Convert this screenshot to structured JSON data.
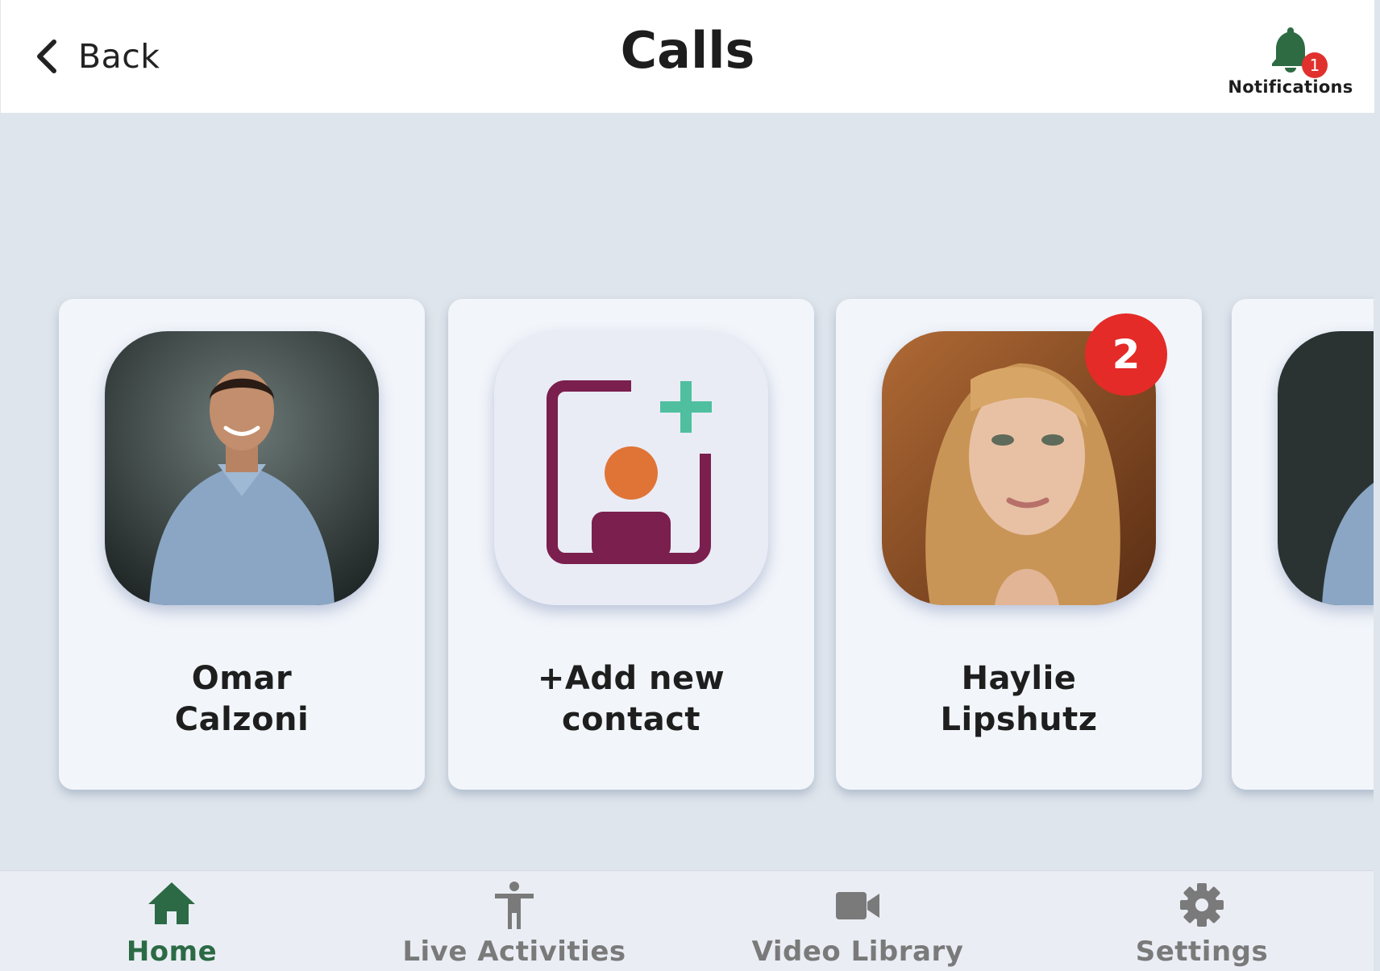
{
  "header": {
    "back_label": "Back",
    "title": "Calls",
    "notifications": {
      "label": "Notifications",
      "count": "1",
      "icon": "bell-icon",
      "icon_color": "#2e6b43",
      "badge_color": "#e0312e"
    }
  },
  "contacts": [
    {
      "first": "Omar",
      "last": "Calzoni",
      "badge": null
    },
    {
      "first": "+Add new",
      "last": "contact",
      "action": "add-contact"
    },
    {
      "first": "Haylie",
      "last": "Lipshutz",
      "badge": "2"
    }
  ],
  "nav": {
    "items": [
      {
        "label": "Home",
        "icon": "home-icon",
        "active": true
      },
      {
        "label": "Live Activities",
        "icon": "accessibility-person-icon",
        "active": false
      },
      {
        "label": "Video Library",
        "icon": "video-camera-icon",
        "active": false
      },
      {
        "label": "Settings",
        "icon": "gear-icon",
        "active": false
      }
    ],
    "active_color": "#2b6a45",
    "inactive_color": "#7a7a7a"
  },
  "colors": {
    "background": "#dfe5ec",
    "card": "#f2f5fa",
    "add_contact_frame": "#7a1f4e",
    "add_contact_plus": "#4fbf9f",
    "add_contact_head": "#e07436"
  }
}
